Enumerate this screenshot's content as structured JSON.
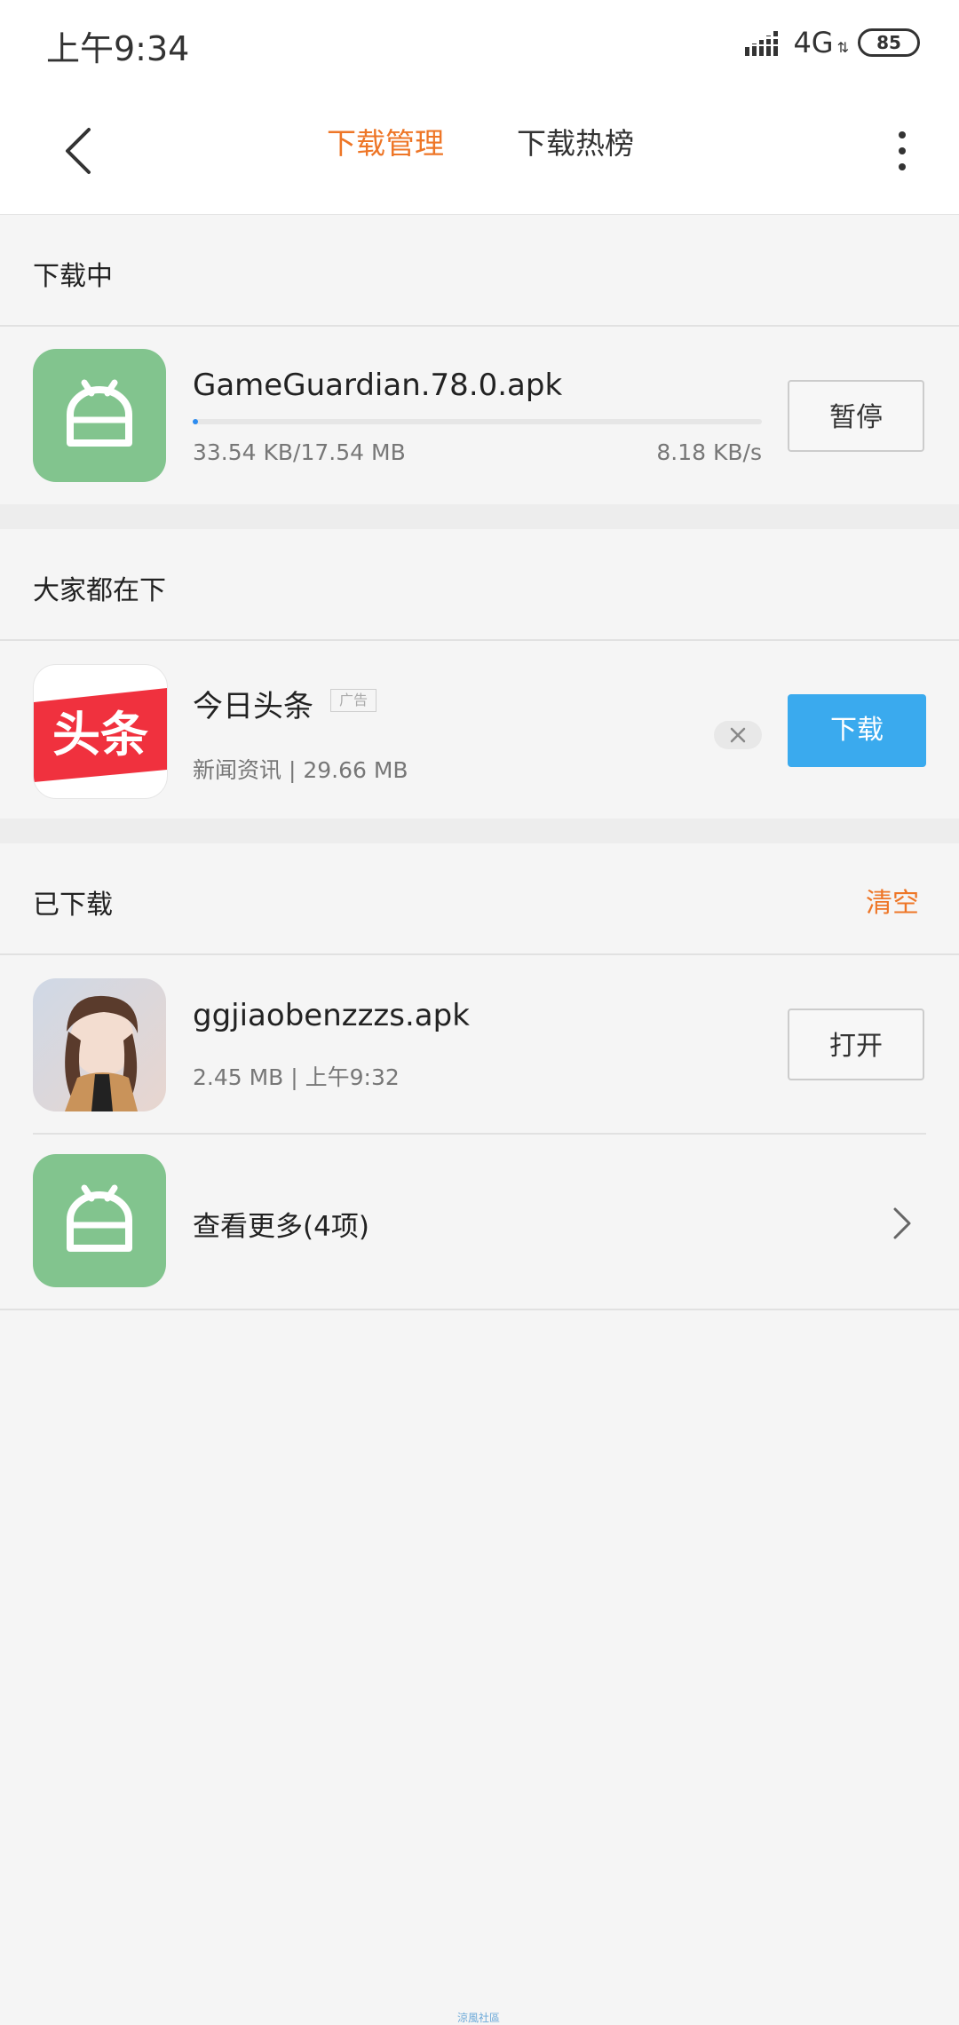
{
  "status_bar": {
    "time": "上午9:34",
    "network": "4G",
    "network_arrows": "⇅",
    "battery": "85"
  },
  "top_bar": {
    "tabs": [
      {
        "label": "下载管理",
        "active": true
      },
      {
        "label": "下载热榜",
        "active": false
      }
    ],
    "back_icon": "chevron-left-icon",
    "more_icon": "more-vertical-icon"
  },
  "downloading": {
    "section_title": "下载中",
    "item": {
      "name": "GameGuardian.78.0.apk",
      "size_progress": "33.54 KB/17.54 MB",
      "speed": "8.18 KB/s",
      "progress_fraction": 0.0019,
      "button_label": "暂停",
      "icon": "android-package-icon"
    }
  },
  "popular": {
    "section_title": "大家都在下",
    "item": {
      "name": "今日头条",
      "ad_label": "广告",
      "meta": "新闻资讯 | 29.66 MB",
      "icon_text": "头条",
      "button_label": "下载"
    }
  },
  "downloaded": {
    "section_title": "已下载",
    "clear_label": "清空",
    "item": {
      "name": "ggjiaobenzzzs.apk",
      "meta": "2.45 MB | 上午9:32",
      "button_label": "打开"
    },
    "more_label": "查看更多(4项)"
  },
  "watermark": "涼風社區",
  "colors": {
    "accent": "#ee7627",
    "download_blue": "#3aaaee",
    "progress_blue": "#2d8cf0",
    "icon_green": "#82c48e",
    "brand_red": "#f0313e"
  }
}
